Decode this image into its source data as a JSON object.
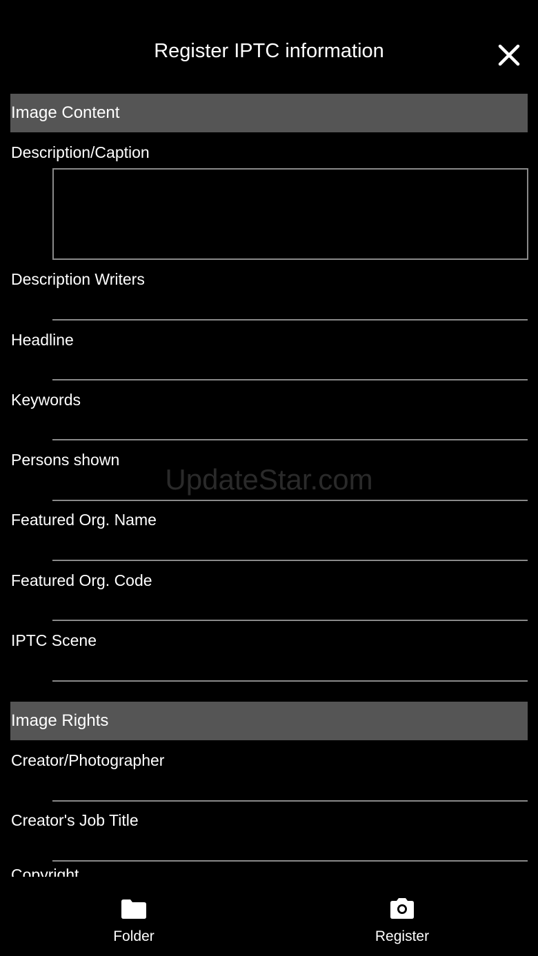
{
  "header": {
    "title": "Register IPTC information",
    "close_icon": "close-icon"
  },
  "sections": {
    "content": {
      "title": "Image Content"
    },
    "rights": {
      "title": "Image Rights"
    }
  },
  "fields": {
    "description_caption": "Description/Caption",
    "description_writers": "Description Writers",
    "headline": "Headline",
    "keywords": "Keywords",
    "persons_shown": "Persons shown",
    "featured_org_name": "Featured Org. Name",
    "featured_org_code": "Featured Org. Code",
    "iptc_scene": "IPTC Scene",
    "creator_photographer": "Creator/Photographer",
    "creators_job_title": "Creator's Job Title",
    "copyright_partial": "Copyright"
  },
  "watermark": "UpdateStar.com",
  "tabbar": {
    "folder": {
      "label": "Folder",
      "icon": "folder-icon"
    },
    "register": {
      "label": "Register",
      "icon": "camera-icon"
    }
  }
}
